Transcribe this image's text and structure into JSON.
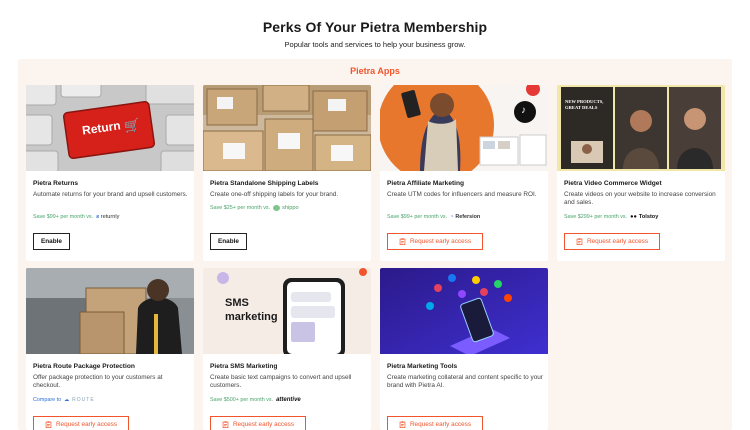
{
  "header": {
    "title": "Perks Of Your Pietra Membership",
    "subtitle": "Popular tools and services to help your business grow."
  },
  "section": {
    "label": "Pietra Apps"
  },
  "thumbs": {
    "returns_key": "Return",
    "sms_art": "SMS\nmarketing",
    "video_overlay": "NEW PRODUCTS,\nGREAT DEALS"
  },
  "cards": [
    {
      "title": "Pietra Returns",
      "desc": "Automate returns for your brand and upsell customers.",
      "save": "Save $99+ per month vs.",
      "brand": "returnly",
      "button": "Enable"
    },
    {
      "title": "Pietra Standalone Shipping Labels",
      "desc": "Create one-off shipping labels for your brand.",
      "save": "Save $25+ per month vs.",
      "brand": "shippo",
      "button": "Enable"
    },
    {
      "title": "Pietra Affiliate Marketing",
      "desc": "Create UTM codes for influencers and measure ROI.",
      "save": "Save $99+ per month vs.",
      "brand": "Refersion",
      "button": "Request early access"
    },
    {
      "title": "Pietra Video Commerce Widget",
      "desc": "Create videos on your website to increase conversion and sales.",
      "save": "Save $299+ per month vs.",
      "brand": "Tolstoy",
      "button": "Request early access"
    },
    {
      "title": "Pietra Route Package Protection",
      "desc": "Offer package protection to your customers at checkout.",
      "save": "Compare to",
      "brand": "ROUTE",
      "button": "Request early access"
    },
    {
      "title": "Pietra SMS Marketing",
      "desc": "Create basic text campaigns to convert and upsell customers.",
      "save": "Save $500+ per month vs.",
      "brand": "attentive",
      "button": "Request early access"
    },
    {
      "title": "Pietra Marketing Tools",
      "desc": "Create marketing collateral and content specific to your brand with Pietra AI.",
      "save": "",
      "brand": "",
      "button": "Request early access"
    }
  ],
  "colors": {
    "accent": "#f2552c",
    "panel": "#fbf4ef",
    "save_green": "#47a36b"
  }
}
